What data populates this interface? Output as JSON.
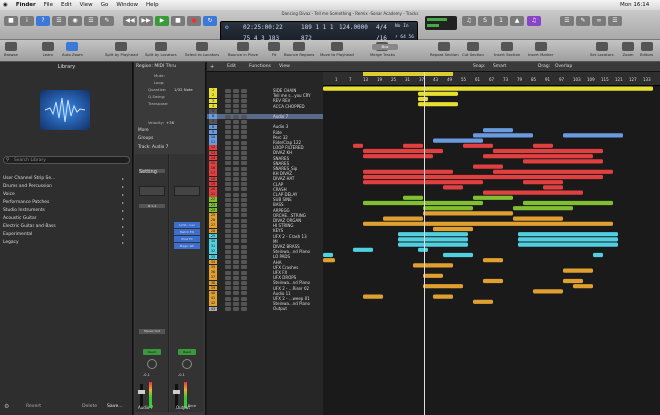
{
  "menubar": {
    "apple": "",
    "items": [
      "Finder",
      "File",
      "Edit",
      "View",
      "Go",
      "Window",
      "Help"
    ],
    "window_title": "Dancing Divaz - Tell me Something - Remix -Sonar Academy - Tracks",
    "clock": "Mon 16:14"
  },
  "lcd": {
    "position_time": "02:25:00:22",
    "position_bars": "75  4  3 183",
    "bar2": "189  1  1  1",
    "tempo": "124.0000",
    "tempo_label": "124.0000",
    "sig": "4/4",
    "sig2": "/16",
    "in": "No In",
    "out": "No Out",
    "bars_small": "872",
    "key": "♯ 64 56",
    "cpu": "CPU",
    "hd": "HD"
  },
  "toolbar": {
    "items": [
      "Browse",
      "Learn",
      "Auto Zoom",
      "Split by Playhead",
      "Split by Locators",
      "Select to Locators",
      "Bounce in Place",
      "Fit",
      "Bounce Regions",
      "Move to Playhead",
      "Merge Tracks",
      "Repeat Section",
      "Cut Section",
      "Insert Section",
      "Insert Marker",
      "Set Locators",
      "Zoom",
      "Editors"
    ],
    "badge": "Bus"
  },
  "library": {
    "title": "Library",
    "search_placeholder": "Search Library",
    "items": [
      "User Channel Strip Se...",
      "Drums and Percussion",
      "Voice",
      "Performance Patches",
      "Studio Instruments",
      "Acoustic Guitar",
      "Electric Guitar and Bass",
      "Experimental",
      "Legacy"
    ],
    "revert": "Revert",
    "delete": "Delete",
    "save": "Save..."
  },
  "inspector": {
    "region_header": "Region: MIDI Thru",
    "fields": [
      "Mute:",
      "Loop:",
      "Quantize:",
      "Q-Swing:",
      "Transpose:",
      "Velocity:"
    ],
    "quantize_value": "1/32 Note",
    "velocity_value": "+36",
    "more": "More",
    "groups": "Groups",
    "track_header": "Track: Audio 7",
    "strip_labels": [
      "Setting",
      "Setting",
      "EQ",
      "EQ",
      "Input",
      "Input",
      "Audio FX",
      "Audio FX",
      "Stereo Out",
      "Read",
      "Read"
    ],
    "fx": [
      "Limit...iver",
      "Match EQ",
      "Phat FX",
      "Magic Wh"
    ],
    "mixer_values": [
      "-0.1",
      "0.0",
      "-0.1",
      "0.0"
    ],
    "bottom": [
      "Audio 7",
      "Output"
    ],
    "bounce": "Bnce"
  },
  "tracks_header": {
    "edit": "Edit",
    "functions": "Functions",
    "view": "View",
    "snap": "Snap:",
    "snap_val": "Smart",
    "drag": "Drag:",
    "drag_val": "Overlap"
  },
  "ruler": [
    "1",
    "7",
    "13",
    "19",
    "25",
    "31",
    "37",
    "43",
    "49",
    "55",
    "61",
    "67",
    "73",
    "79",
    "85",
    "91",
    "97",
    "103",
    "109",
    "115",
    "121",
    "127",
    "133"
  ],
  "tracks": [
    {
      "n": "1",
      "name": "SIDE CHAIN",
      "c": "#e8e030"
    },
    {
      "n": "2",
      "name": "Tell me s...you CRY",
      "c": "#e8e030"
    },
    {
      "n": "3",
      "name": "REV REV",
      "c": "#e8e030"
    },
    {
      "n": "4",
      "name": "ACCA CHOPPED",
      "c": "#e8e030"
    },
    {
      "n": "5",
      "name": "",
      "c": "#555"
    },
    {
      "n": "6",
      "name": "Audio 7",
      "c": "#6a9ae0"
    },
    {
      "n": "7",
      "name": "",
      "c": "#555"
    },
    {
      "n": "8",
      "name": "Audio 3",
      "c": "#6a9ae0"
    },
    {
      "n": "9",
      "name": "Ride",
      "c": "#6a9ae0"
    },
    {
      "n": "10",
      "name": "Perc 32",
      "c": "#6a9ae0"
    },
    {
      "n": "11",
      "name": "Ride/Clap 122",
      "c": "#6a9ae0"
    },
    {
      "n": "12",
      "name": "LOOP FILTERED",
      "c": "#e04040"
    },
    {
      "n": "13",
      "name": "DIVAZ KH",
      "c": "#e04040"
    },
    {
      "n": "14",
      "name": "SNARES",
      "c": "#e04040"
    },
    {
      "n": "15",
      "name": "SNARES",
      "c": "#e04040"
    },
    {
      "n": "16",
      "name": "SNARES_Sip",
      "c": "#e04040"
    },
    {
      "n": "17",
      "name": "KH DIVAZ",
      "c": "#e04040"
    },
    {
      "n": "18",
      "name": "DIVAZ HAT",
      "c": "#e04040"
    },
    {
      "n": "19",
      "name": "CLAP",
      "c": "#e04040"
    },
    {
      "n": "20",
      "name": "CRASH",
      "c": "#e04040"
    },
    {
      "n": "21",
      "name": "CLAP DELAY",
      "c": "#e04040"
    },
    {
      "n": "22",
      "name": "SUB SINE",
      "c": "#80c030"
    },
    {
      "n": "23",
      "name": "BASS",
      "c": "#80c030"
    },
    {
      "n": "24",
      "name": "ARPEGG",
      "c": "#80c030"
    },
    {
      "n": "25",
      "name": "ORCHE...STRING",
      "c": "#e0a030"
    },
    {
      "n": "26",
      "name": "DIVAZ ORGAN",
      "c": "#e0a030"
    },
    {
      "n": "27",
      "name": "HI STRING",
      "c": "#e0a030"
    },
    {
      "n": "28",
      "name": "KEYS",
      "c": "#e0a030"
    },
    {
      "n": "29",
      "name": "UFX 2 - Crash 13",
      "c": "#50d0e0"
    },
    {
      "n": "30",
      "name": "MI",
      "c": "#50d0e0"
    },
    {
      "n": "31",
      "name": "DIVAZ BRASS",
      "c": "#50d0e0"
    },
    {
      "n": "32",
      "name": "Steinwa...nd Piano",
      "c": "#50d0e0"
    },
    {
      "n": "33",
      "name": "LO PADS",
      "c": "#50d0e0"
    },
    {
      "n": "34",
      "name": "AHA",
      "c": "#e0a030"
    },
    {
      "n": "35",
      "name": "UFX Crashes",
      "c": "#e0a030"
    },
    {
      "n": "36",
      "name": "UFX FX",
      "c": "#e0a030"
    },
    {
      "n": "37",
      "name": "UFX DROPS",
      "c": "#e0a030"
    },
    {
      "n": "38",
      "name": "Steinwa...nd Piano",
      "c": "#e0a030"
    },
    {
      "n": "39",
      "name": "UFX 2 - ...Riser 02",
      "c": "#e0a030"
    },
    {
      "n": "40",
      "name": "Audio 11",
      "c": "#e0a030"
    },
    {
      "n": "41",
      "name": "UFX 2 - ...weep 01",
      "c": "#e0a030"
    },
    {
      "n": "42",
      "name": "Steinwa...nd Piano",
      "c": "#e0a030"
    },
    {
      "n": "43",
      "name": "Output",
      "c": "#aaa"
    }
  ],
  "colors": {
    "yellow": "#e8e030",
    "red": "#e04040",
    "green": "#80c030",
    "orange": "#e0a030",
    "cyan": "#50d0e0",
    "purple": "#b050e0",
    "blue": "#6a9ae0",
    "playhead": "#dddddd"
  }
}
